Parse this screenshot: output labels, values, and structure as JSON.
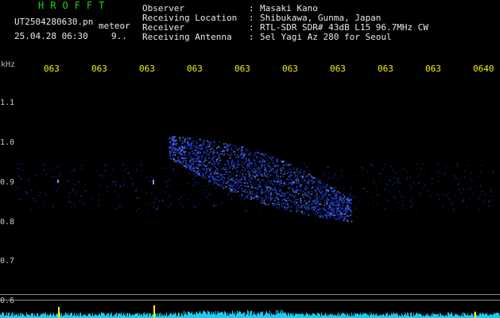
{
  "app_title": "HROFFT",
  "file_name": "UT2504280630.pn",
  "event_tag": "meteor",
  "datetime": "25.04.28 06:30",
  "event_count": "9..",
  "info": [
    {
      "label": "Observer",
      "value": "Masaki Kano"
    },
    {
      "label": "Receiving Location",
      "value": "Shibukawa, Gunma, Japan"
    },
    {
      "label": "Receiver",
      "value": "RTL-SDR SDR# 43dB L15 96.7MHz CW"
    },
    {
      "label": "Receiving Antenna",
      "value": "5el Yagi Az 280 for Seoul"
    }
  ],
  "freq_unit": "kHz",
  "time_ticks": [
    "063",
    "063",
    "063",
    "063",
    "063",
    "063",
    "063",
    "063",
    "063",
    "0640"
  ],
  "freq_ticks": [
    "1.1",
    "1.0",
    "0.9",
    "0.8",
    "0.7",
    "0.6"
  ],
  "colors": {
    "title": "#19d819",
    "header_text": "#e8e8e8",
    "tick_text": "#f2f200",
    "signal": "#2a4bff",
    "baseline_noise": "#19d8ff",
    "background": "#000000"
  }
}
